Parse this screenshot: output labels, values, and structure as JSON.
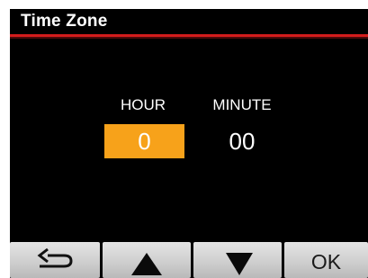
{
  "header": {
    "title": "Time Zone"
  },
  "time_zone": {
    "hour_label": "HOUR",
    "minute_label": "MINUTE",
    "hour_value": "0",
    "minute_value": "00",
    "selected_field": "hour"
  },
  "softkeys": {
    "back_icon": "back-arrow-icon",
    "up_icon": "up-triangle-icon",
    "down_icon": "down-triangle-icon",
    "ok_label": "OK"
  },
  "colors": {
    "background": "#000000",
    "title_rule": "#d31c1c",
    "selection": "#f7a21a",
    "text": "#ffffff",
    "softkey": "#d4d4d4"
  }
}
